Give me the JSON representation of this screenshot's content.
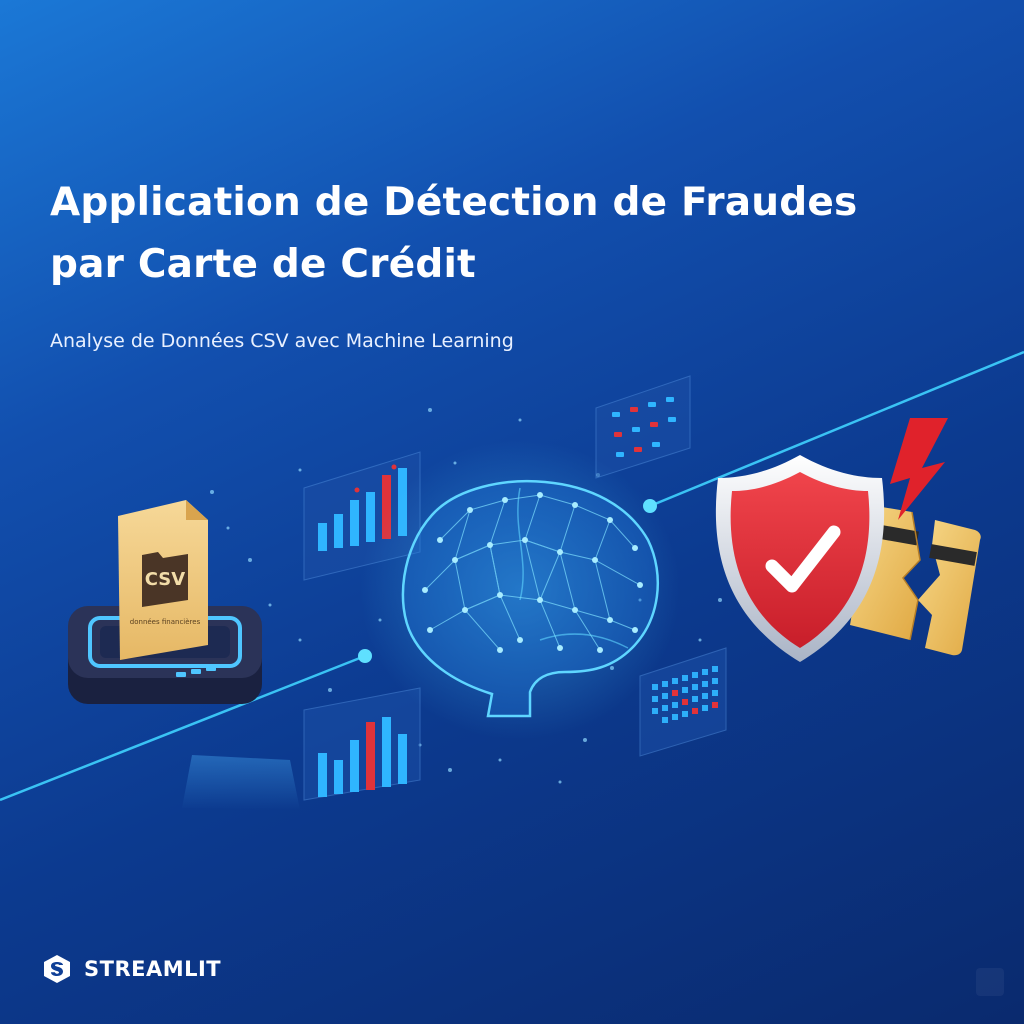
{
  "hero": {
    "title_line1": "Application de Détection de Fraudes",
    "title_line2": "par Carte de Crédit",
    "subtitle": "Analyse de Données CSV avec Machine Learning"
  },
  "csv_file": {
    "badge": "CSV",
    "caption": "données financières"
  },
  "brand": {
    "name": "STREAMLIT",
    "icon": "streamlit-logo-icon"
  },
  "icons": {
    "brain": "neural-network-brain-icon",
    "shield": "security-shield-check-icon",
    "card": "broken-credit-card-icon",
    "alert": "lightning-alert-icon"
  },
  "colors": {
    "bg_top": "#1b78d6",
    "bg_bottom": "#0a2a6e",
    "accent_cyan": "#3fd2ff",
    "shield_red": "#e8333b",
    "card_gold": "#f0c060"
  }
}
